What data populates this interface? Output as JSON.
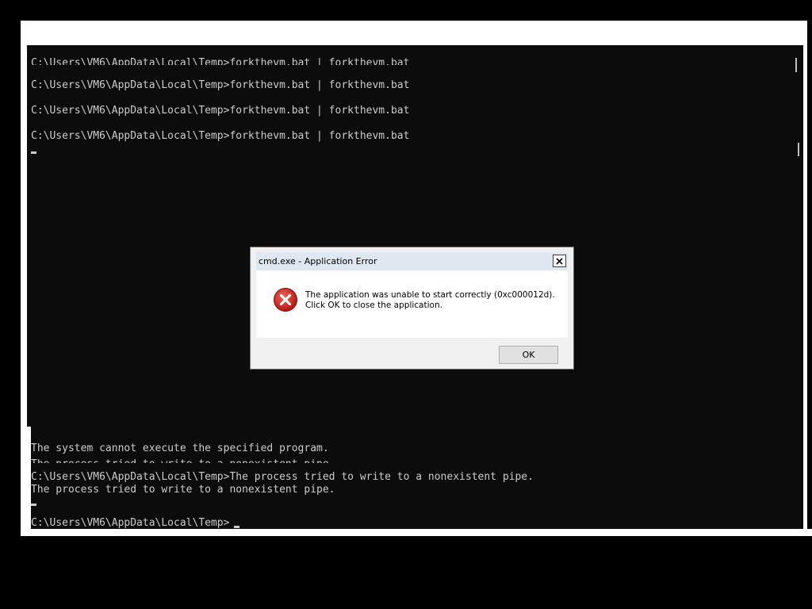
{
  "console": {
    "lines_top": [
      "C:\\Users\\VM6\\AppData\\Local\\Temp>forkthevm.bat | forkthevm.bat",
      "C:\\Users\\VM6\\AppData\\Local\\Temp>forkthevm.bat | forkthevm.bat",
      "C:\\Users\\VM6\\AppData\\Local\\Temp>forkthevm.bat | forkthevm.bat",
      "C:\\Users\\VM6\\AppData\\Local\\Temp>forkthevm.bat | forkthevm.bat"
    ],
    "lines_bottom": [
      "The system cannot execute the specified program.",
      "The process tried to write to a nonexistent pipe.",
      "C:\\Users\\VM6\\AppData\\Local\\Temp>The process tried to write to a nonexistent pipe.",
      "The process tried to write to a nonexistent pipe.",
      "C:\\Users\\VM6\\AppData\\Local\\Temp>"
    ],
    "text_color": "#cccccc",
    "background_color": "#0c0c0c"
  },
  "dialog": {
    "title": "cmd.exe - Application Error",
    "message_line1": "The application was unable to start correctly (0xc000012d).",
    "message_line2": "Click OK to close the application.",
    "ok_label": "OK",
    "icon": "error-icon",
    "icon_color": "#c42b1c",
    "title_bar_color": "#dfe7f1"
  }
}
